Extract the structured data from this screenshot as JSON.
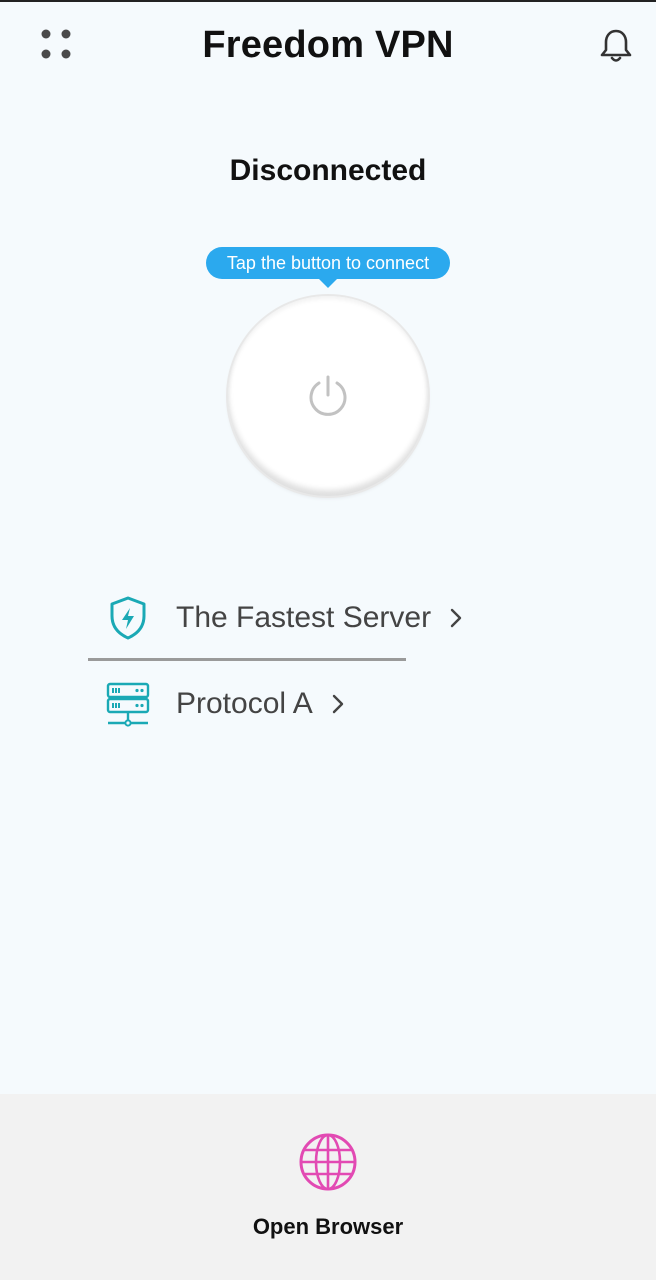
{
  "header": {
    "title": "Freedom VPN",
    "menu_icon": "grid-dots-icon",
    "notification_icon": "bell-icon"
  },
  "status": {
    "text": "Disconnected"
  },
  "connect": {
    "tooltip": "Tap the button to connect",
    "power_icon": "power-icon"
  },
  "options": {
    "server": {
      "label": "The Fastest Server",
      "icon": "shield-bolt-icon"
    },
    "protocol": {
      "label": "Protocol A",
      "icon": "server-rack-icon"
    }
  },
  "bottom": {
    "browser_label": "Open Browser",
    "browser_icon": "globe-icon"
  },
  "colors": {
    "accent": "#2ba9ee",
    "teal": "#1aa9b5",
    "browser_pink": "#e24ab3",
    "background": "#f5fafd"
  }
}
